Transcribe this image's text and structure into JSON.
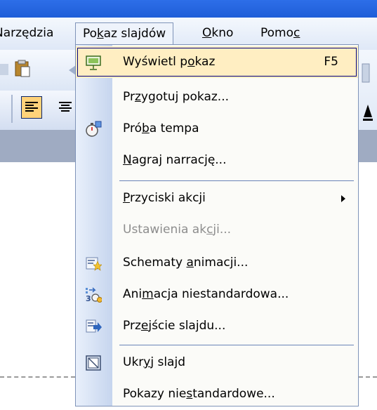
{
  "menubar": {
    "items": [
      {
        "label": "Narzędzia"
      },
      {
        "label_pre": "Po",
        "label_ul": "k",
        "label_post": "az slajdów"
      },
      {
        "label_pre": "",
        "label_ul": "O",
        "label_post": "kno"
      },
      {
        "label_pre": "Pomo",
        "label_ul": "c",
        "label_post": ""
      }
    ]
  },
  "menu": {
    "items": [
      {
        "pre": "Wyświetl p",
        "ul": "o",
        "post": "kaz",
        "shortcut": "F5",
        "icon": "projector-screen-icon",
        "state": "highlighted"
      },
      {
        "pre": "Pr",
        "ul": "z",
        "post": "ygotuj pokaz..."
      },
      {
        "pre": "Pró",
        "ul": "b",
        "post": "a tempa",
        "icon": "stopwatch-icon"
      },
      {
        "pre": "",
        "ul": "N",
        "post": "agraj narrację..."
      },
      {
        "pre": "",
        "ul": "P",
        "post": "rzyciski akcji",
        "submenu": true
      },
      {
        "pre": "Ustawienia ak",
        "ul": "c",
        "post": "ji...",
        "state": "disabled"
      },
      {
        "pre": "Schematy ",
        "ul": "a",
        "post": "nimacji...",
        "icon": "animation-scheme-icon"
      },
      {
        "pre": "Ani",
        "ul": "m",
        "post": "acja niestandardowa...",
        "icon": "custom-animation-icon"
      },
      {
        "pre": "Prz",
        "ul": "e",
        "post": "jście slajdu...",
        "icon": "slide-transition-icon"
      },
      {
        "pre": "Ukr",
        "ul": "y",
        "post": "j slajd",
        "icon": "hide-slide-icon"
      },
      {
        "pre": "Pokazy nie",
        "ul": "s",
        "post": "tandardowe..."
      }
    ]
  },
  "colors": {
    "title_bar": "#2d6ee8",
    "menu_highlight": "#ffeec2",
    "menu_border": "#7f93b8",
    "separator": "#6a83b8",
    "disabled_text": "#8d8d8d"
  }
}
